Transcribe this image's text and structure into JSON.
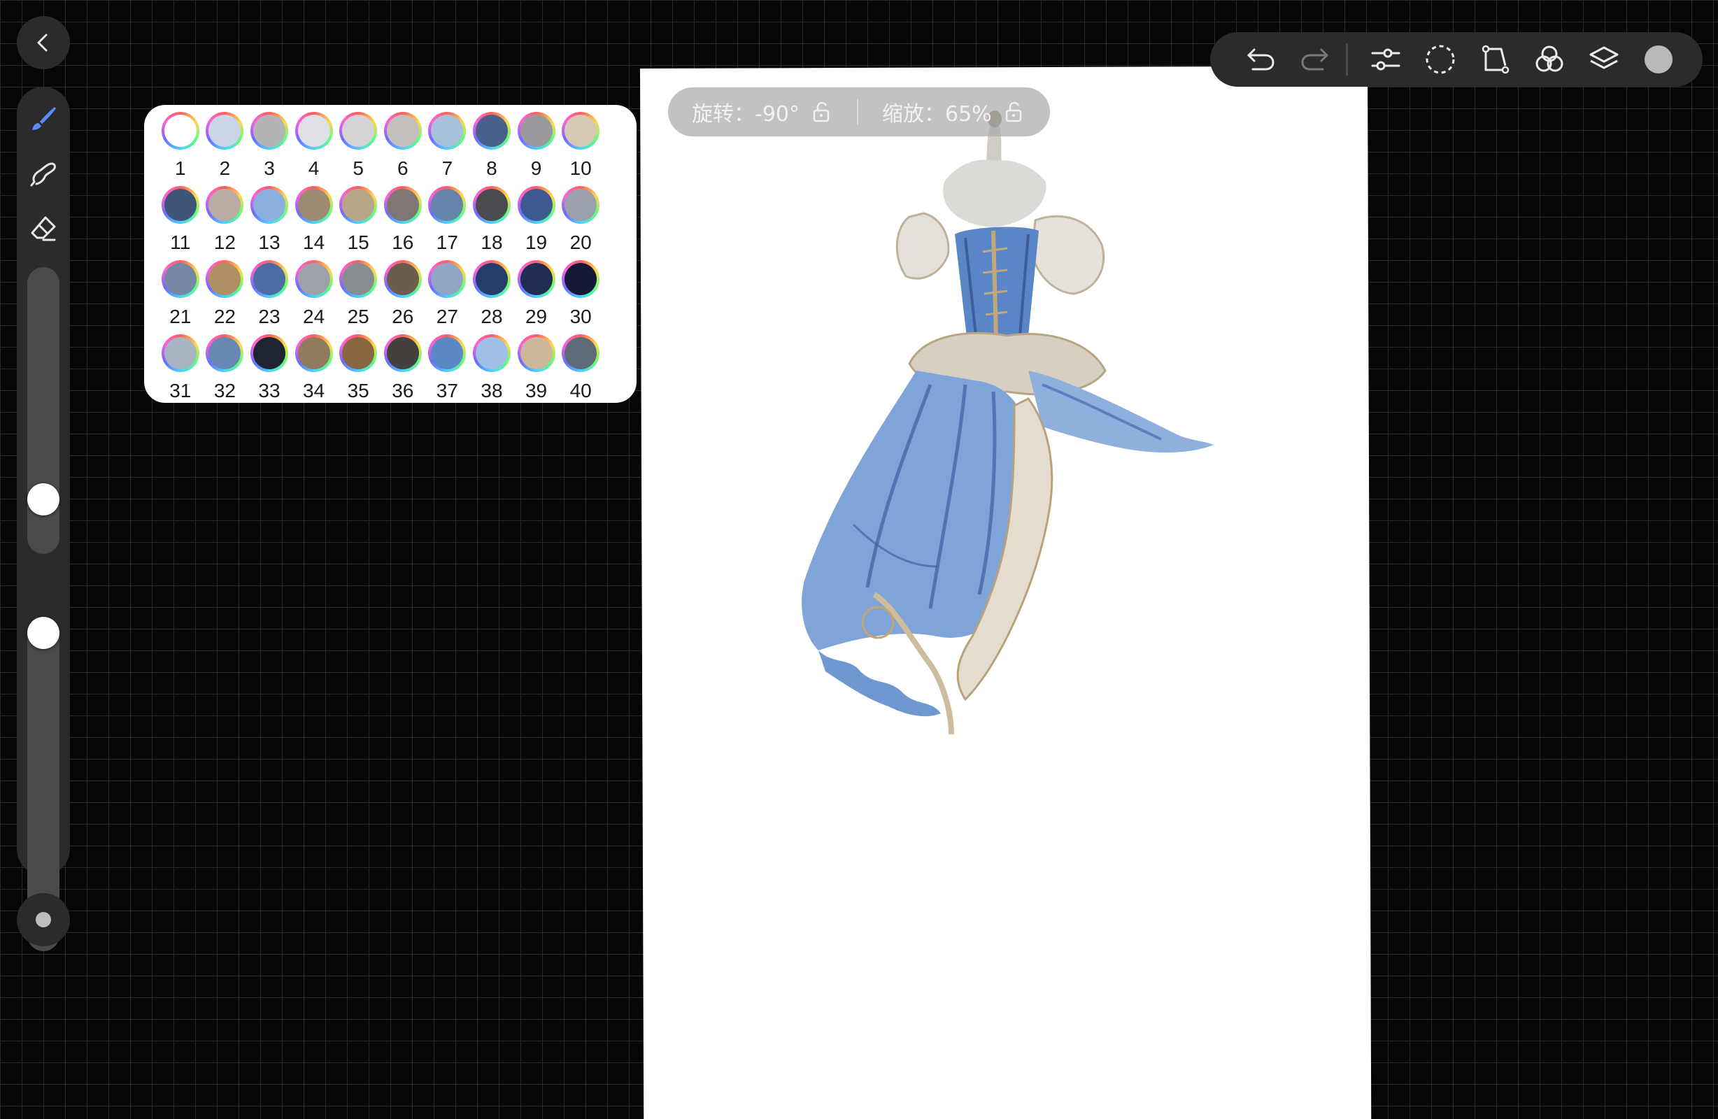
{
  "hud": {
    "rotation_label": "旋转：-90°",
    "zoom_label": "缩放：65%"
  },
  "toolbar": {
    "items": [
      "undo-icon",
      "redo-icon",
      "adjustments-icon",
      "selection-icon",
      "transform-icon",
      "blend-icon",
      "layers-icon",
      "color-icon"
    ],
    "current_color": "#b9b9b9"
  },
  "tools": [
    "brush-icon",
    "smudge-icon",
    "eraser-icon"
  ],
  "sliders": {
    "brush_size": 0.15,
    "opacity": 1.0
  },
  "palette": {
    "swatches": [
      {
        "label": "1",
        "color": "#ffffff"
      },
      {
        "label": "2",
        "color": "#cbd5ea"
      },
      {
        "label": "3",
        "color": "#b4b4b6"
      },
      {
        "label": "4",
        "color": "#e0e0e6"
      },
      {
        "label": "5",
        "color": "#d5d3d6"
      },
      {
        "label": "6",
        "color": "#c4bfbd"
      },
      {
        "label": "7",
        "color": "#a7c0dc"
      },
      {
        "label": "8",
        "color": "#48608a"
      },
      {
        "label": "9",
        "color": "#9a9a9e"
      },
      {
        "label": "10",
        "color": "#d6c8b3"
      },
      {
        "label": "11",
        "color": "#3f5577"
      },
      {
        "label": "12",
        "color": "#b8aca4"
      },
      {
        "label": "13",
        "color": "#8cb0de"
      },
      {
        "label": "14",
        "color": "#9c8a72"
      },
      {
        "label": "15",
        "color": "#b9a587"
      },
      {
        "label": "16",
        "color": "#7f7773"
      },
      {
        "label": "17",
        "color": "#6484aa"
      },
      {
        "label": "18",
        "color": "#4a4a50"
      },
      {
        "label": "19",
        "color": "#3d5a8e"
      },
      {
        "label": "20",
        "color": "#9aa1ad"
      },
      {
        "label": "21",
        "color": "#7487a3"
      },
      {
        "label": "22",
        "color": "#b08f62"
      },
      {
        "label": "23",
        "color": "#4b6da3"
      },
      {
        "label": "24",
        "color": "#a0a2aa"
      },
      {
        "label": "25",
        "color": "#898d91"
      },
      {
        "label": "26",
        "color": "#6b5c4c"
      },
      {
        "label": "27",
        "color": "#8fa7c4"
      },
      {
        "label": "28",
        "color": "#253d6b"
      },
      {
        "label": "29",
        "color": "#1f2d52"
      },
      {
        "label": "30",
        "color": "#151836"
      },
      {
        "label": "31",
        "color": "#a8b3c4"
      },
      {
        "label": "32",
        "color": "#6788b4"
      },
      {
        "label": "33",
        "color": "#1e2430"
      },
      {
        "label": "34",
        "color": "#927a5e"
      },
      {
        "label": "35",
        "color": "#8a6542"
      },
      {
        "label": "36",
        "color": "#43403e"
      },
      {
        "label": "37",
        "color": "#5b87c4"
      },
      {
        "label": "38",
        "color": "#9fc0e4"
      },
      {
        "label": "39",
        "color": "#cdb699"
      },
      {
        "label": "40",
        "color": "#5e6a78"
      }
    ]
  }
}
